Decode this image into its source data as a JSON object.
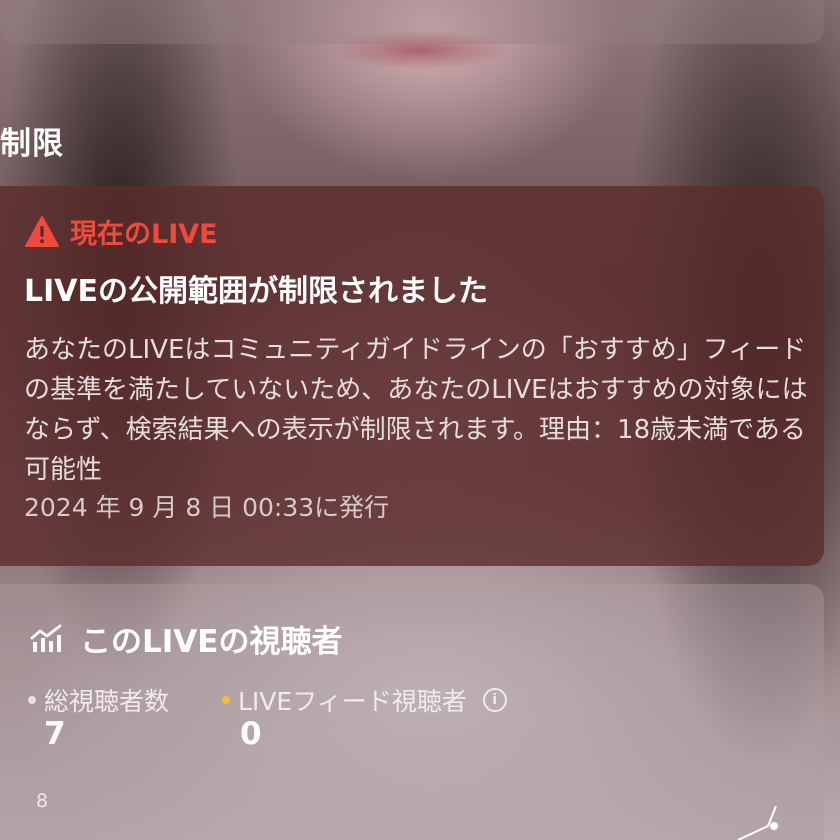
{
  "colors": {
    "warning": "#f04a3e",
    "total_dot": "#e9e2e2",
    "feed_dot": "#f2c230"
  },
  "section": {
    "title": "制限"
  },
  "alert": {
    "icon": "warning-triangle-icon",
    "status": "現在のLIVE",
    "title": "LIVEの公開範囲が制限されました",
    "body": "あなたのLIVEはコミュニティガイドラインの「おすすめ」フィードの基準を満たしていないため、あなたのLIVEはおすすめの対象にはならず、検索結果への表示が制限されます。理由：18歳未満である可能性",
    "date": "2024 年 9 月 8 日 00:33に発行"
  },
  "viewers": {
    "icon": "analytics-chart-icon",
    "title": "このLIVEの視聴者",
    "total": {
      "label": "総視聴者数",
      "value": "7"
    },
    "feed": {
      "label": "LIVEフィード視聴者",
      "value": "0",
      "info_icon": "info-icon"
    },
    "chart_axis_label": "8"
  }
}
